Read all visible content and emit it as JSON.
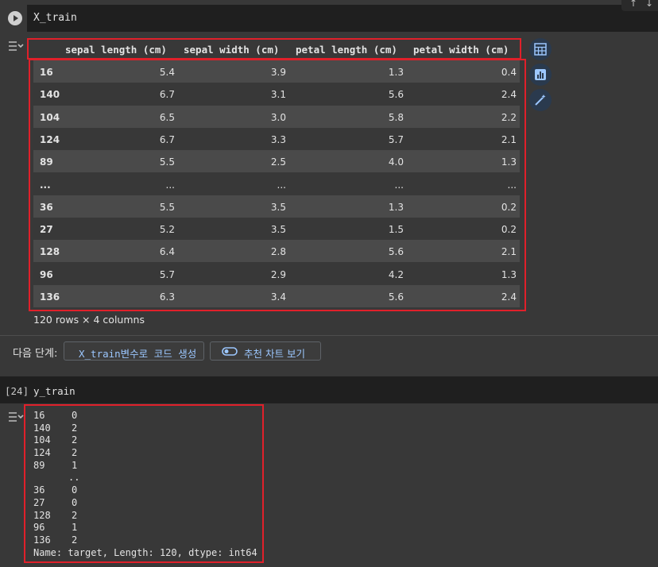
{
  "cell1": {
    "code": "X_train"
  },
  "dataframe": {
    "columns": [
      "sepal length (cm)",
      "sepal width (cm)",
      "petal length (cm)",
      "petal width (cm)"
    ],
    "rows": [
      {
        "idx": "16",
        "c1": "5.4",
        "c2": "3.9",
        "c3": "1.3",
        "c4": "0.4"
      },
      {
        "idx": "140",
        "c1": "6.7",
        "c2": "3.1",
        "c3": "5.6",
        "c4": "2.4"
      },
      {
        "idx": "104",
        "c1": "6.5",
        "c2": "3.0",
        "c3": "5.8",
        "c4": "2.2"
      },
      {
        "idx": "124",
        "c1": "6.7",
        "c2": "3.3",
        "c3": "5.7",
        "c4": "2.1"
      },
      {
        "idx": "89",
        "c1": "5.5",
        "c2": "2.5",
        "c3": "4.0",
        "c4": "1.3"
      },
      {
        "idx": "...",
        "c1": "...",
        "c2": "...",
        "c3": "...",
        "c4": "..."
      },
      {
        "idx": "36",
        "c1": "5.5",
        "c2": "3.5",
        "c3": "1.3",
        "c4": "0.2"
      },
      {
        "idx": "27",
        "c1": "5.2",
        "c2": "3.5",
        "c3": "1.5",
        "c4": "0.2"
      },
      {
        "idx": "128",
        "c1": "6.4",
        "c2": "2.8",
        "c3": "5.6",
        "c4": "2.1"
      },
      {
        "idx": "96",
        "c1": "5.7",
        "c2": "2.9",
        "c3": "4.2",
        "c4": "1.3"
      },
      {
        "idx": "136",
        "c1": "6.3",
        "c2": "3.4",
        "c3": "5.6",
        "c4": "2.4"
      }
    ],
    "shape_note": "120 rows × 4 columns"
  },
  "next_steps": {
    "label": "다음 단계:",
    "generate_code": "X_train변수로 코드 생성",
    "recommended_charts": "추천 차트 보기"
  },
  "cell2": {
    "exec_count": "[24]",
    "code": "y_train"
  },
  "series_output": {
    "lines": [
      {
        "idx": "16",
        "val": "0"
      },
      {
        "idx": "140",
        "val": "2"
      },
      {
        "idx": "104",
        "val": "2"
      },
      {
        "idx": "124",
        "val": "2"
      },
      {
        "idx": "89",
        "val": "1"
      },
      {
        "idx": "",
        "val": ".."
      },
      {
        "idx": "36",
        "val": "0"
      },
      {
        "idx": "27",
        "val": "0"
      },
      {
        "idx": "128",
        "val": "2"
      },
      {
        "idx": "96",
        "val": "1"
      },
      {
        "idx": "136",
        "val": "2"
      }
    ],
    "footer": "Name: target, Length: 120, dtype: int64"
  },
  "icons": {
    "run": "play-icon",
    "output_toggle": "output-toggle-icon",
    "table": "table-icon",
    "chart": "bar-chart-icon",
    "magic": "magic-wand-icon",
    "toggle": "toggle-icon"
  },
  "colors": {
    "highlight": "#e0202a",
    "link": "#9cc7ff",
    "side_button": "#2a3a4e"
  }
}
